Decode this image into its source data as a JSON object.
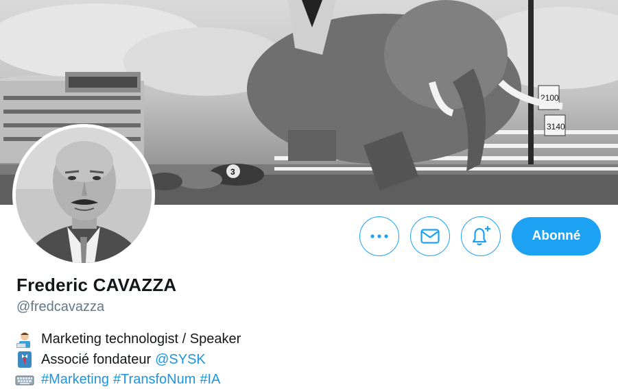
{
  "profile": {
    "display_name": "Frederic CAVAZZA",
    "handle": "@fredcavazza"
  },
  "actions": {
    "more_icon": "more-dots-icon",
    "message_icon": "envelope-icon",
    "notify_icon": "bell-plus-icon",
    "follow_label": "Abonné"
  },
  "bio": {
    "line1": {
      "emoji": "technologist-emoji",
      "text": "Marketing technologist / Speaker"
    },
    "line2": {
      "emoji": "office-worker-emoji",
      "text": "Associé fondateur",
      "mention": "@SYSK"
    },
    "line3": {
      "emoji": "keyboard-emoji",
      "hashtags": [
        "#Marketing",
        "#TransfoNum",
        "#IA"
      ]
    }
  },
  "banner": {
    "sign_1": "2100",
    "sign_2": "3140",
    "jersey_number": "3"
  },
  "colors": {
    "accent": "#1da1f2",
    "link": "#1b95e0",
    "text": "#14171a",
    "muted": "#657786"
  }
}
